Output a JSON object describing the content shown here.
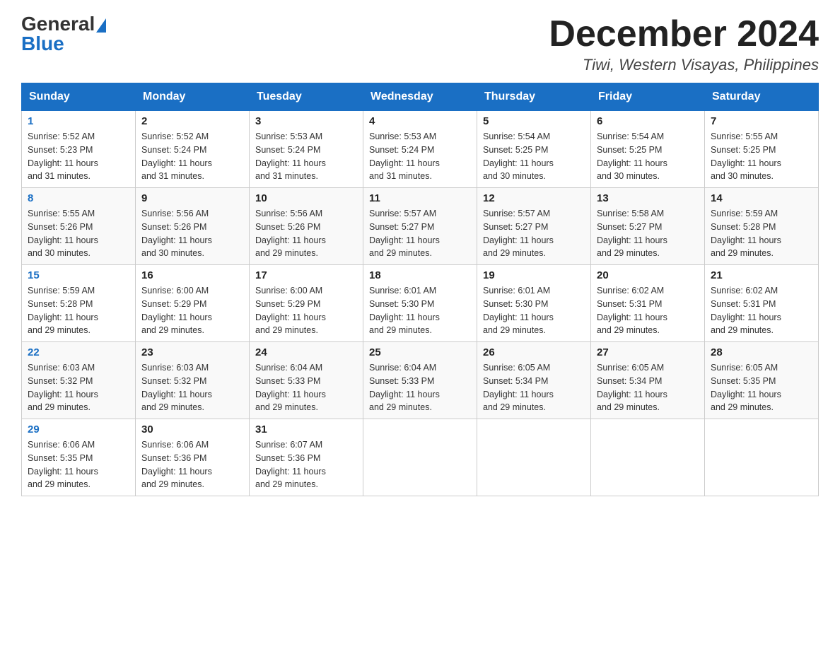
{
  "header": {
    "logo_general": "General",
    "logo_blue": "Blue",
    "month_title": "December 2024",
    "location": "Tiwi, Western Visayas, Philippines"
  },
  "days_of_week": [
    "Sunday",
    "Monday",
    "Tuesday",
    "Wednesday",
    "Thursday",
    "Friday",
    "Saturday"
  ],
  "weeks": [
    [
      {
        "day": "1",
        "sunrise": "5:52 AM",
        "sunset": "5:23 PM",
        "daylight": "11 hours and 31 minutes."
      },
      {
        "day": "2",
        "sunrise": "5:52 AM",
        "sunset": "5:24 PM",
        "daylight": "11 hours and 31 minutes."
      },
      {
        "day": "3",
        "sunrise": "5:53 AM",
        "sunset": "5:24 PM",
        "daylight": "11 hours and 31 minutes."
      },
      {
        "day": "4",
        "sunrise": "5:53 AM",
        "sunset": "5:24 PM",
        "daylight": "11 hours and 31 minutes."
      },
      {
        "day": "5",
        "sunrise": "5:54 AM",
        "sunset": "5:25 PM",
        "daylight": "11 hours and 30 minutes."
      },
      {
        "day": "6",
        "sunrise": "5:54 AM",
        "sunset": "5:25 PM",
        "daylight": "11 hours and 30 minutes."
      },
      {
        "day": "7",
        "sunrise": "5:55 AM",
        "sunset": "5:25 PM",
        "daylight": "11 hours and 30 minutes."
      }
    ],
    [
      {
        "day": "8",
        "sunrise": "5:55 AM",
        "sunset": "5:26 PM",
        "daylight": "11 hours and 30 minutes."
      },
      {
        "day": "9",
        "sunrise": "5:56 AM",
        "sunset": "5:26 PM",
        "daylight": "11 hours and 30 minutes."
      },
      {
        "day": "10",
        "sunrise": "5:56 AM",
        "sunset": "5:26 PM",
        "daylight": "11 hours and 29 minutes."
      },
      {
        "day": "11",
        "sunrise": "5:57 AM",
        "sunset": "5:27 PM",
        "daylight": "11 hours and 29 minutes."
      },
      {
        "day": "12",
        "sunrise": "5:57 AM",
        "sunset": "5:27 PM",
        "daylight": "11 hours and 29 minutes."
      },
      {
        "day": "13",
        "sunrise": "5:58 AM",
        "sunset": "5:27 PM",
        "daylight": "11 hours and 29 minutes."
      },
      {
        "day": "14",
        "sunrise": "5:59 AM",
        "sunset": "5:28 PM",
        "daylight": "11 hours and 29 minutes."
      }
    ],
    [
      {
        "day": "15",
        "sunrise": "5:59 AM",
        "sunset": "5:28 PM",
        "daylight": "11 hours and 29 minutes."
      },
      {
        "day": "16",
        "sunrise": "6:00 AM",
        "sunset": "5:29 PM",
        "daylight": "11 hours and 29 minutes."
      },
      {
        "day": "17",
        "sunrise": "6:00 AM",
        "sunset": "5:29 PM",
        "daylight": "11 hours and 29 minutes."
      },
      {
        "day": "18",
        "sunrise": "6:01 AM",
        "sunset": "5:30 PM",
        "daylight": "11 hours and 29 minutes."
      },
      {
        "day": "19",
        "sunrise": "6:01 AM",
        "sunset": "5:30 PM",
        "daylight": "11 hours and 29 minutes."
      },
      {
        "day": "20",
        "sunrise": "6:02 AM",
        "sunset": "5:31 PM",
        "daylight": "11 hours and 29 minutes."
      },
      {
        "day": "21",
        "sunrise": "6:02 AM",
        "sunset": "5:31 PM",
        "daylight": "11 hours and 29 minutes."
      }
    ],
    [
      {
        "day": "22",
        "sunrise": "6:03 AM",
        "sunset": "5:32 PM",
        "daylight": "11 hours and 29 minutes."
      },
      {
        "day": "23",
        "sunrise": "6:03 AM",
        "sunset": "5:32 PM",
        "daylight": "11 hours and 29 minutes."
      },
      {
        "day": "24",
        "sunrise": "6:04 AM",
        "sunset": "5:33 PM",
        "daylight": "11 hours and 29 minutes."
      },
      {
        "day": "25",
        "sunrise": "6:04 AM",
        "sunset": "5:33 PM",
        "daylight": "11 hours and 29 minutes."
      },
      {
        "day": "26",
        "sunrise": "6:05 AM",
        "sunset": "5:34 PM",
        "daylight": "11 hours and 29 minutes."
      },
      {
        "day": "27",
        "sunrise": "6:05 AM",
        "sunset": "5:34 PM",
        "daylight": "11 hours and 29 minutes."
      },
      {
        "day": "28",
        "sunrise": "6:05 AM",
        "sunset": "5:35 PM",
        "daylight": "11 hours and 29 minutes."
      }
    ],
    [
      {
        "day": "29",
        "sunrise": "6:06 AM",
        "sunset": "5:35 PM",
        "daylight": "11 hours and 29 minutes."
      },
      {
        "day": "30",
        "sunrise": "6:06 AM",
        "sunset": "5:36 PM",
        "daylight": "11 hours and 29 minutes."
      },
      {
        "day": "31",
        "sunrise": "6:07 AM",
        "sunset": "5:36 PM",
        "daylight": "11 hours and 29 minutes."
      },
      null,
      null,
      null,
      null
    ]
  ],
  "labels": {
    "sunrise": "Sunrise:",
    "sunset": "Sunset:",
    "daylight": "Daylight:"
  }
}
